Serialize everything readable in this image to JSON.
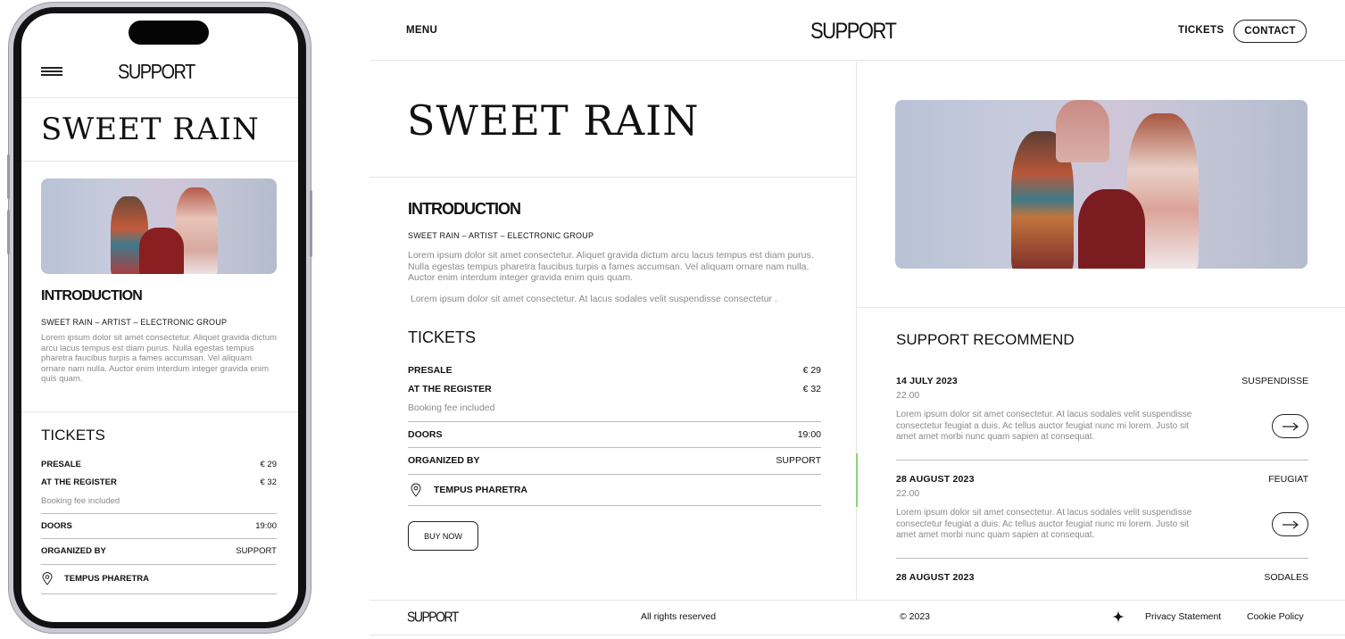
{
  "phone": {
    "logo": "SUPPORT",
    "title": "SWEET RAIN",
    "intro_heading": "INTRODUCTION",
    "intro_sub": "SWEET RAIN – ARTIST – ELECTRONIC GROUP",
    "intro_text": "Lorem ipsum dolor sit amet consectetur. Aliquet gravida dictum arcu lacus tempus est diam purus. Nulla egestas tempus pharetra faucibus turpis a fames accumsan. Vel aliquam ornare nam nulla. Auctor enim interdum integer gravida enim quis quam.",
    "tickets_heading": "TICKETS",
    "presale_label": "PRESALE",
    "presale_price": "€ 29",
    "register_label": "AT THE REGISTER",
    "register_price": "€ 32",
    "fee_note": "Booking fee included",
    "doors_label": "DOORS",
    "doors_value": "19:00",
    "organized_label": "ORGANIZED BY",
    "organized_value": "SUPPORT",
    "location": "TEMPUS PHARETRA"
  },
  "header": {
    "menu": "MENU",
    "logo": "SUPPORT",
    "tickets": "TICKETS",
    "contact": "CONTACT"
  },
  "main": {
    "title": "SWEET RAIN",
    "intro_heading": "INTRODUCTION",
    "intro_sub": "SWEET RAIN – ARTIST – ELECTRONIC GROUP",
    "intro_text_1": "Lorem ipsum dolor sit amet consectetur. Aliquet gravida dictum arcu lacus tempus est diam purus. Nulla egestas tempus pharetra faucibus turpis a fames accumsan. Vel aliquam ornare nam nulla. Auctor enim interdum integer gravida enim quis quam.",
    "intro_text_2": "Lorem ipsum dolor sit amet consectetur. At lacus sodales velit suspendisse consectetur .",
    "tickets_heading": "TICKETS",
    "presale_label": "PRESALE",
    "presale_price": "€ 29",
    "register_label": "AT THE REGISTER",
    "register_price": "€ 32",
    "fee_note": "Booking fee included",
    "doors_label": "DOORS",
    "doors_value": "19:00",
    "organized_label": "ORGANIZED BY",
    "organized_value": "SUPPORT",
    "location": "TEMPUS PHARETRA",
    "buy_now": "BUY NOW"
  },
  "recommend": {
    "heading": "SUPPORT RECOMMEND",
    "items": [
      {
        "date": "14 JULY 2023",
        "time": "22.00",
        "tag": "SUSPENDISSE",
        "text": "Lorem ipsum dolor sit amet consectetur. At lacus sodales velit suspendisse consectetur feugiat a duis. Ac tellus auctor feugiat nunc mi lorem. Justo sit amet amet morbi nunc quam sapien at consequat."
      },
      {
        "date": "28 AUGUST 2023",
        "time": "22.00",
        "tag": "FEUGIAT",
        "text": "Lorem ipsum dolor sit amet consectetur. At lacus sodales velit suspendisse consectetur feugiat a duis. Ac tellus auctor feugiat nunc mi lorem. Justo sit amet amet morbi nunc quam sapien at consequat."
      },
      {
        "date": "28 AUGUST 2023",
        "tag": "SODALES"
      }
    ]
  },
  "footer": {
    "logo": "SUPPORT",
    "rights": "All rights reserved",
    "copyright": "© 2023",
    "privacy": "Privacy Statement",
    "cookie": "Cookie Policy"
  },
  "colors": {
    "accent": "#8bd37a",
    "text": "#111111",
    "muted": "#8a8a8a"
  }
}
